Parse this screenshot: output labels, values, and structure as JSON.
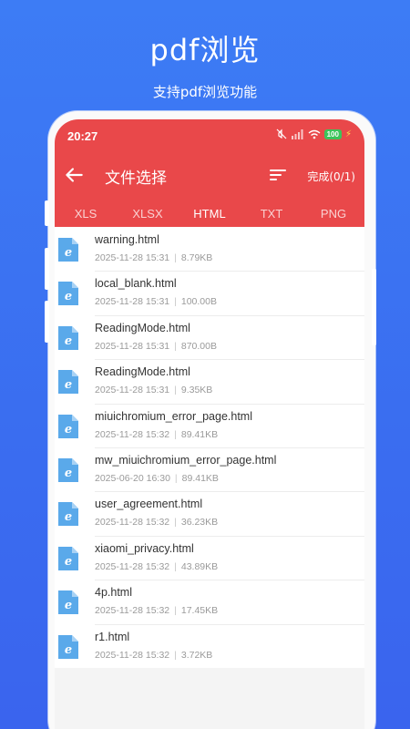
{
  "promo": {
    "title": "pdf浏览",
    "subtitle": "支持pdf浏览功能"
  },
  "status_bar": {
    "time": "20:27",
    "battery": "100"
  },
  "header": {
    "title": "文件选择",
    "done_label": "完成(0/1)"
  },
  "tabs": [
    {
      "label": "XLS"
    },
    {
      "label": "XLSX"
    },
    {
      "label": "HTML"
    },
    {
      "label": "TXT"
    },
    {
      "label": "PNG"
    }
  ],
  "active_tab": "HTML",
  "files": [
    {
      "name": "warning.html",
      "date": "2025-11-28 15:31",
      "size": "8.79KB"
    },
    {
      "name": "local_blank.html",
      "date": "2025-11-28 15:31",
      "size": "100.00B"
    },
    {
      "name": "ReadingMode.html",
      "date": "2025-11-28 15:31",
      "size": "870.00B"
    },
    {
      "name": "ReadingMode.html",
      "date": "2025-11-28 15:31",
      "size": "9.35KB"
    },
    {
      "name": "miuichromium_error_page.html",
      "date": "2025-11-28 15:32",
      "size": "89.41KB"
    },
    {
      "name": "mw_miuichromium_error_page.html",
      "date": "2025-06-20 16:30",
      "size": "89.41KB"
    },
    {
      "name": "user_agreement.html",
      "date": "2025-11-28 15:32",
      "size": "36.23KB"
    },
    {
      "name": "xiaomi_privacy.html",
      "date": "2025-11-28 15:32",
      "size": "43.89KB"
    },
    {
      "name": "4p.html",
      "date": "2025-11-28 15:32",
      "size": "17.45KB"
    },
    {
      "name": "r1.html",
      "date": "2025-11-28 15:32",
      "size": "3.72KB"
    }
  ],
  "colors": {
    "background": "#3d7cf5",
    "appbar": "#e9484a",
    "file_icon": "#5aa9ea",
    "battery": "#3cc35a"
  },
  "icons": {
    "back": "arrow-left-icon",
    "sort": "sort-icon",
    "file": "html-file-icon"
  }
}
